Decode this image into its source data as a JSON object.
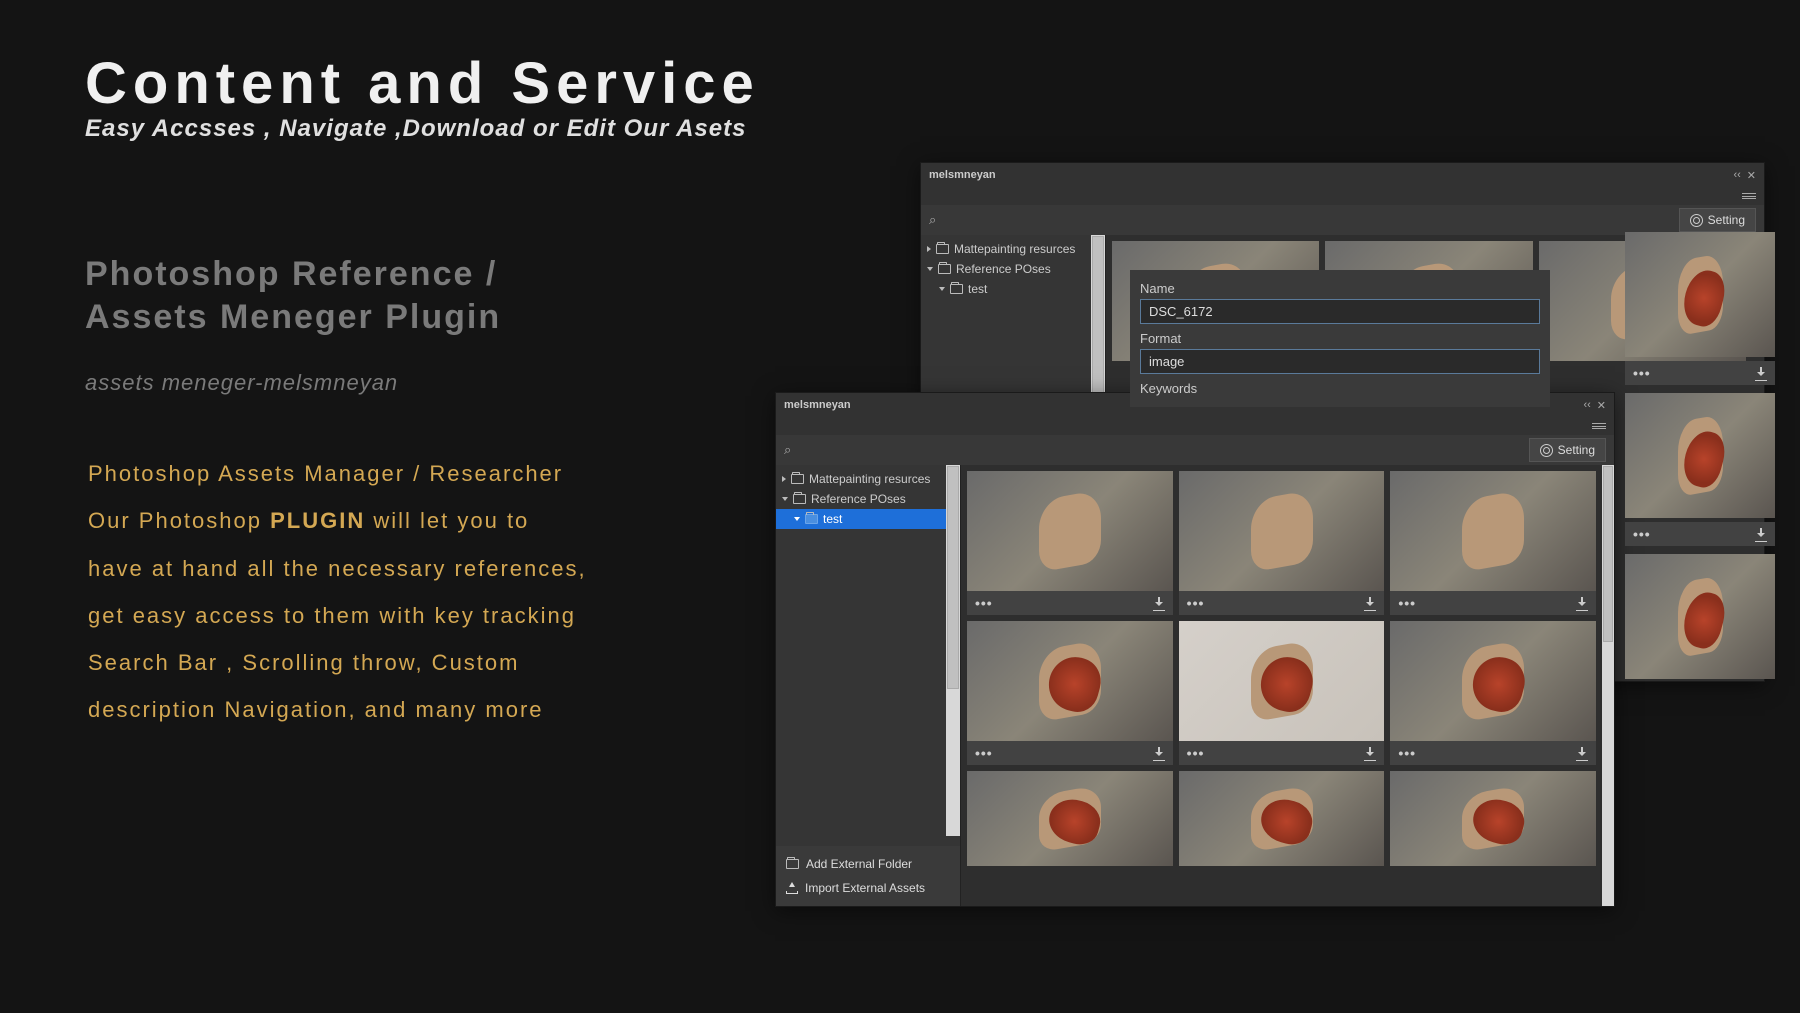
{
  "hero": {
    "title": "Content and Service",
    "subtitle": "Easy Accsses , Navigate ,Download or Edit Our Asets"
  },
  "section": {
    "title_line1": "Photoshop Reference /",
    "title_line2": "Assets Meneger Plugin",
    "subtitle": "assets meneger-melsmneyan"
  },
  "body": {
    "line1": "Photoshop Assets Manager / Researcher",
    "line2a": "Our  Photoshop ",
    "line2b": "PLUGIN",
    "line2c": " will let you to",
    "line3": "have at hand all the necessary references,",
    "line4": "get easy access to them with key tracking",
    "line5": "Search Bar , Scrolling throw, Custom",
    "line6": "description Navigation, and many more"
  },
  "panel_back": {
    "title": "melsmneyan",
    "setting_label": "Setting",
    "tree": {
      "item1": "Mattepainting resurces",
      "item2": "Reference POses",
      "item3": "test"
    }
  },
  "panel_front": {
    "title": "melsmneyan",
    "setting_label": "Setting",
    "tree": {
      "item1": "Mattepainting resurces",
      "item2": "Reference POses",
      "item3": "test"
    },
    "footer": {
      "add_folder": "Add External Folder",
      "import_assets": "Import External Assets"
    }
  },
  "popup": {
    "name_label": "Name",
    "name_value": "DSC_6172",
    "format_label": "Format",
    "format_value": "image",
    "keywords_label": "Keywords"
  }
}
